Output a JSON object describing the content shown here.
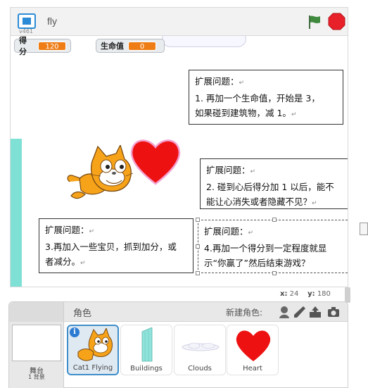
{
  "topbar": {
    "version": "v461",
    "title": "fly"
  },
  "stage": {
    "variables": [
      {
        "label": "得分",
        "value": "120"
      },
      {
        "label": "生命值",
        "value": "0"
      }
    ],
    "notes": [
      {
        "lines": [
          "扩展问题：",
          "1. 再加一个生命值，开始是 3，",
          "如果碰到建筑物，减 1。"
        ]
      },
      {
        "lines": [
          "扩展问题：",
          "2. 碰到心后得分加 1 以后，能不",
          "能让心消失或者隐藏不见？"
        ]
      },
      {
        "lines": [
          "扩展问题：",
          "3.再加入一些宝贝，抓到加分，或",
          "者减分。"
        ]
      },
      {
        "lines": [
          "扩展问题：",
          "4.再加一个得分到一定程度就显",
          "示“你赢了”然后结束游戏？"
        ]
      }
    ],
    "paragraph_mark": "↵"
  },
  "coords": {
    "x_label": "x:",
    "x_value": "24",
    "y_label": "y:",
    "y_value": "180"
  },
  "sprite_pane": {
    "title": "角色",
    "new_sprite_label": "新建角色:",
    "stage_label": "舞台",
    "stage_sub": "1 背景",
    "sprites": [
      {
        "name": "Cat1 Flying",
        "selected": true
      },
      {
        "name": "Buildings",
        "selected": false
      },
      {
        "name": "Clouds",
        "selected": false
      },
      {
        "name": "Heart",
        "selected": false
      }
    ]
  },
  "colors": {
    "accent": "#2b8bd6",
    "variable_value": "#ee7d16",
    "stop": "#e8202a",
    "flag": "#3f8a3f",
    "heart": "#ee1111",
    "selected_tile": "#3f8ec9"
  }
}
